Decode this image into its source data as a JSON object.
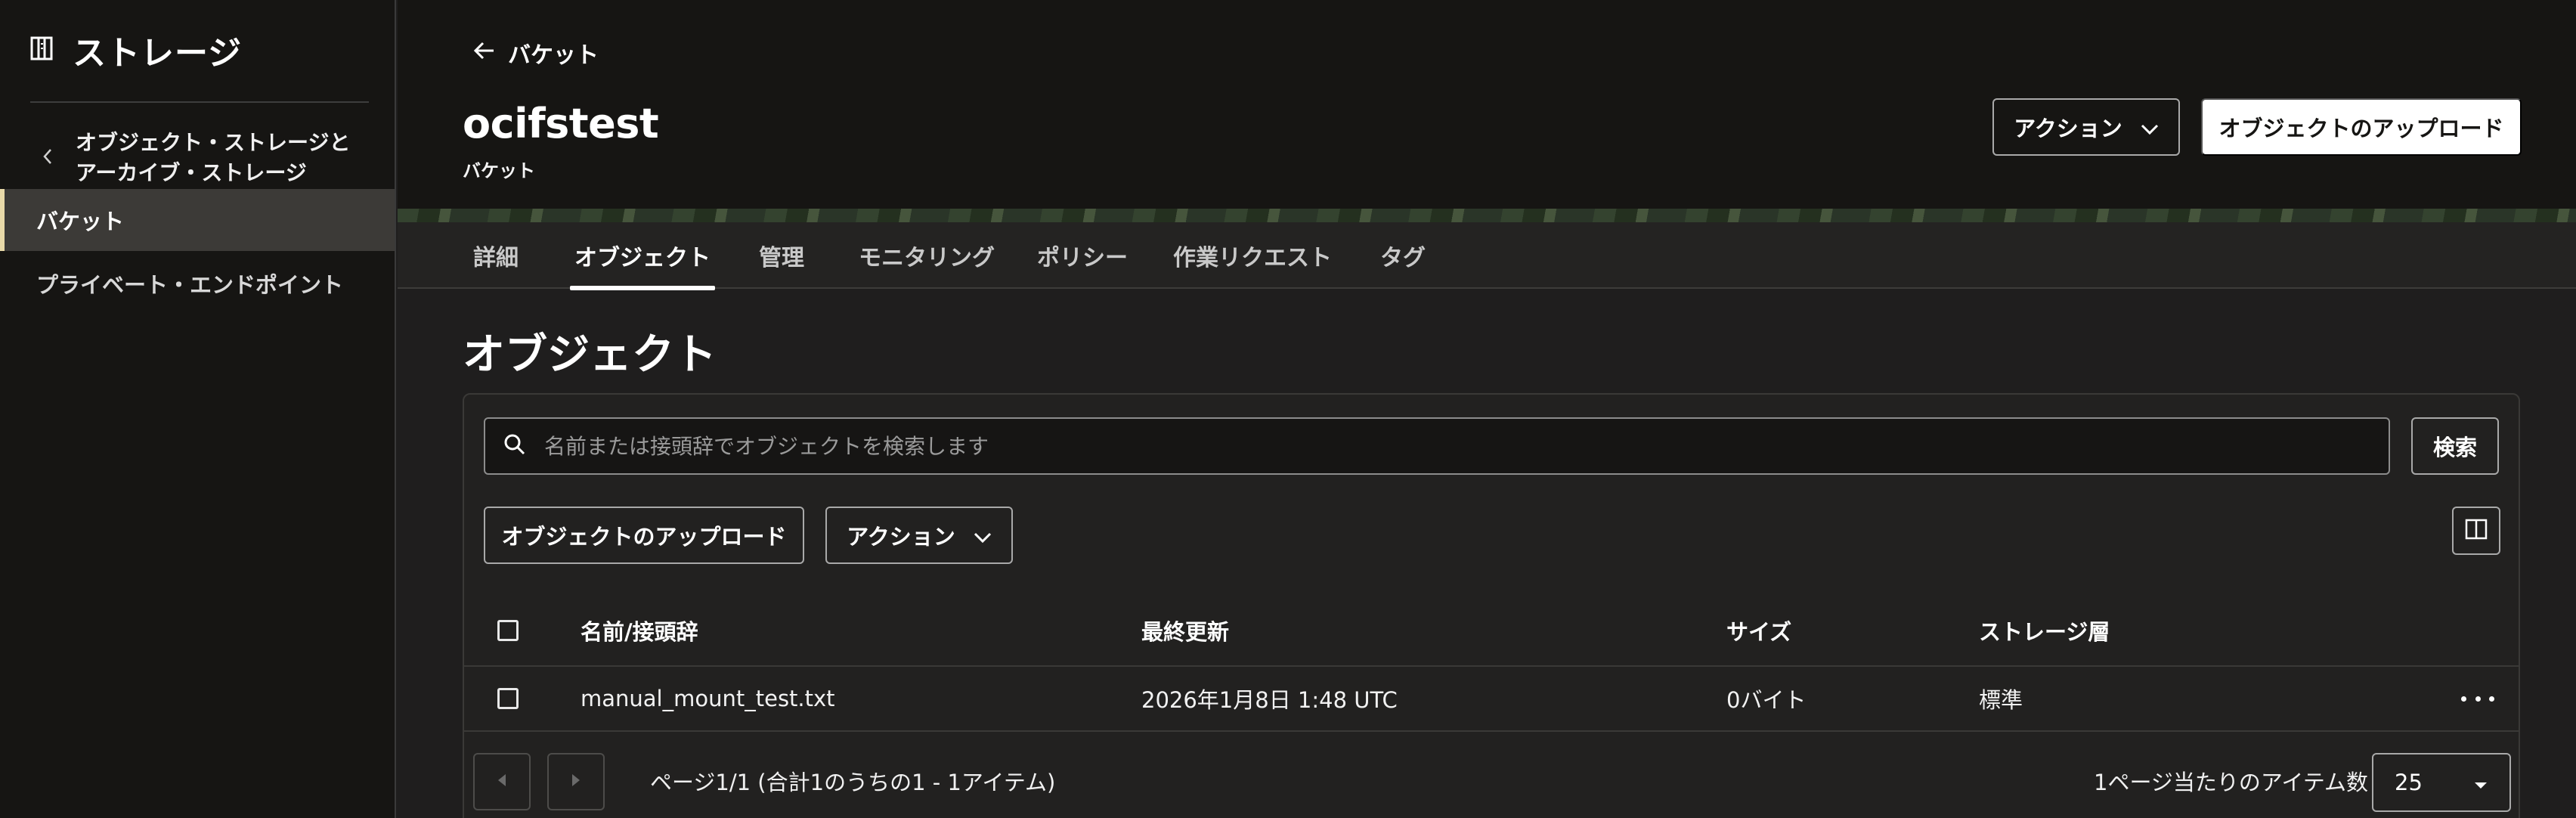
{
  "sidebar": {
    "title": "ストレージ",
    "back_label": "オブジェクト・ストレージと\nアーカイブ・ストレージ",
    "items": [
      {
        "label": "バケット",
        "active": true
      },
      {
        "label": "プライベート・エンドポイント",
        "active": false
      }
    ]
  },
  "header": {
    "back_label": "バケット",
    "title": "ocifstest",
    "subtitle": "バケット",
    "actions_label": "アクション",
    "upload_label": "オブジェクトのアップロード"
  },
  "tabs": [
    {
      "label": "詳細",
      "active": false
    },
    {
      "label": "オブジェクト",
      "active": true
    },
    {
      "label": "管理",
      "active": false
    },
    {
      "label": "モニタリング",
      "active": false
    },
    {
      "label": "ポリシー",
      "active": false
    },
    {
      "label": "作業リクエスト",
      "active": false
    },
    {
      "label": "タグ",
      "active": false
    }
  ],
  "objects": {
    "section_title": "オブジェクト",
    "search_placeholder": "名前または接頭辞でオブジェクトを検索します",
    "search_button": "検索",
    "upload_button": "オブジェクトのアップロード",
    "actions_button": "アクション",
    "columns": [
      "名前/接頭辞",
      "最終更新",
      "サイズ",
      "ストレージ層"
    ],
    "rows": [
      {
        "name": "manual_mount_test.txt",
        "modified": "2026年1月8日 1:48 UTC",
        "size": "0バイト",
        "tier": "標準"
      }
    ],
    "pagination": {
      "summary": "ページ1/1 (合計1のうちの1 - 1アイテム)",
      "per_page_label": "1ページ当たりのアイテム数",
      "per_page_value": "25"
    }
  },
  "colors": {
    "background": "#1f1e1e",
    "sidebar": "#161513",
    "active_accent": "#e8d9a8",
    "primary_button": "#ffffff"
  }
}
